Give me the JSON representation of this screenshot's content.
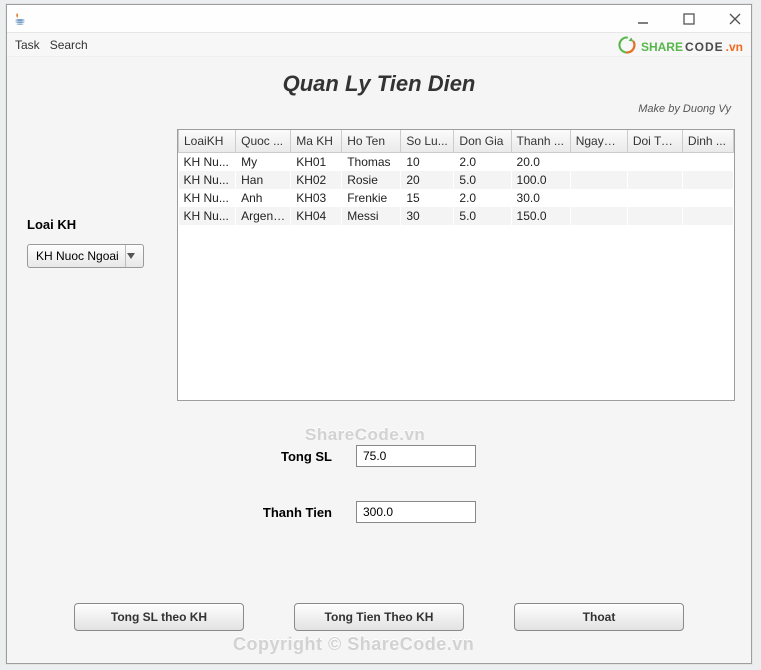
{
  "watermark": {
    "brand_share": "SHARE",
    "brand_code": "CODE",
    "brand_tld": ".vn",
    "center": "ShareCode.vn",
    "bottom": "Copyright © ShareCode.vn"
  },
  "menubar": {
    "task": "Task",
    "search": "Search"
  },
  "header": {
    "title": "Quan Ly Tien Dien",
    "author": "Make by Duong Vy"
  },
  "filter": {
    "label": "Loai KH",
    "selected": "KH Nuoc Ngoai"
  },
  "table": {
    "headers": [
      "LoaiKH",
      "Quoc ...",
      "Ma KH",
      "Ho Ten",
      "So Lu...",
      "Don Gia",
      "Thanh ...",
      "NgayH...",
      "Doi Tu...",
      "Dinh ..."
    ],
    "rows": [
      {
        "loai": "KH Nu...",
        "quoc": "My",
        "ma": "KH01",
        "ten": "Thomas",
        "sl": "10",
        "gia": "2.0",
        "thanh": "20.0",
        "ngay": "",
        "doi": "",
        "dinh": ""
      },
      {
        "loai": "KH Nu...",
        "quoc": "Han",
        "ma": "KH02",
        "ten": "Rosie",
        "sl": "20",
        "gia": "5.0",
        "thanh": "100.0",
        "ngay": "",
        "doi": "",
        "dinh": ""
      },
      {
        "loai": "KH Nu...",
        "quoc": "Anh",
        "ma": "KH03",
        "ten": "Frenkie",
        "sl": "15",
        "gia": "2.0",
        "thanh": "30.0",
        "ngay": "",
        "doi": "",
        "dinh": ""
      },
      {
        "loai": "KH Nu...",
        "quoc": "Argenti...",
        "ma": "KH04",
        "ten": "Messi",
        "sl": "30",
        "gia": "5.0",
        "thanh": "150.0",
        "ngay": "",
        "doi": "",
        "dinh": ""
      }
    ]
  },
  "summary": {
    "tong_sl_label": "Tong SL",
    "tong_sl_value": "75.0",
    "thanh_tien_label": "Thanh Tien",
    "thanh_tien_value": "300.0"
  },
  "buttons": {
    "tong_sl": "Tong SL theo KH",
    "tong_tien": "Tong Tien Theo KH",
    "thoat": "Thoat"
  }
}
